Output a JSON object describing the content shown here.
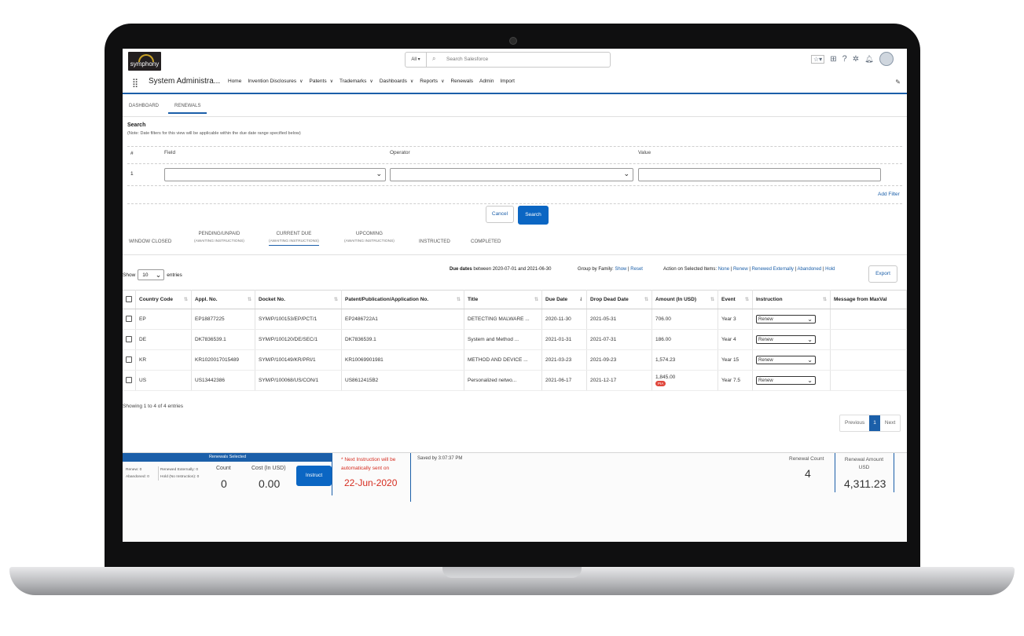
{
  "header": {
    "logo_text": "symphony",
    "search_scope": "All",
    "search_placeholder": "Search Salesforce",
    "app_name": "System Administra...",
    "nav": [
      "Home",
      "Invention Disclosures",
      "Patents",
      "Trademarks",
      "Dashboards",
      "Reports",
      "Renewals",
      "Admin",
      "Import"
    ],
    "nav_has_menu": [
      false,
      true,
      true,
      true,
      true,
      true,
      false,
      false,
      false
    ]
  },
  "subtabs": [
    "DASHBOARD",
    "RENEWALS"
  ],
  "search": {
    "title": "Search",
    "note": "(Note: Date filters for this view will be applicable within the due date range specified below)",
    "col_hash": "#",
    "col_field": "Field",
    "col_operator": "Operator",
    "col_value": "Value",
    "row_number": "1",
    "add_filter": "Add Filter",
    "cancel": "Cancel",
    "search": "Search"
  },
  "status_tabs": [
    {
      "label": "WINDOW CLOSED",
      "sub": ""
    },
    {
      "label": "PENDING/UNPAID",
      "sub": "(AWAITING INSTRUCTIONS)"
    },
    {
      "label": "CURRENT DUE",
      "sub": "(AWAITING INSTRUCTIONS)"
    },
    {
      "label": "UPCOMING",
      "sub": "(AWAITING INSTRUCTIONS)"
    },
    {
      "label": "INSTRUCTED",
      "sub": ""
    },
    {
      "label": "COMPLETED",
      "sub": ""
    }
  ],
  "toolbar": {
    "show": "Show",
    "entries_value": "10",
    "entries": "entries",
    "due_dates_label": "Due dates",
    "due_dates_range": "between 2020-07-01 and 2021-06-30",
    "group_by": "Group by Family:",
    "group_show": "Show",
    "group_reset": "Reset",
    "action_label": "Action on Selected Items:",
    "actions": [
      "None",
      "Renew",
      "Renewed Externally",
      "Abandoned",
      "Hold"
    ],
    "export": "Export"
  },
  "table": {
    "headers": [
      "Country Code",
      "Appl. No.",
      "Docket No.",
      "Patent/Publication/Application No.",
      "Title",
      "Due Date",
      "Drop Dead Date",
      "Amount (In USD)",
      "Event",
      "Instruction",
      "Message from MaxVal"
    ],
    "rows": [
      {
        "country": "EP",
        "appl": "EP18877225",
        "docket": "SYM/P/100153/EP/PCT/1",
        "patent": "EP2486722A1",
        "title": "DETECTING MALWARE ...",
        "due": "2020-11-30",
        "drop": "2021-05-31",
        "amount": "706.00",
        "event": "Year 3",
        "instruction": "Renew",
        "badge": ""
      },
      {
        "country": "DE",
        "appl": "DK7836539.1",
        "docket": "SYM/P/100120/DE/SEC/1",
        "patent": "DK7836539.1",
        "title": "System and Method ...",
        "due": "2021-01-31",
        "drop": "2021-07-31",
        "amount": "186.00",
        "event": "Year 4",
        "instruction": "Renew",
        "badge": ""
      },
      {
        "country": "KR",
        "appl": "KR1020017015489",
        "docket": "SYM/P/100149/KR/PRI/1",
        "patent": "KR10069901981",
        "title": "METHOD AND DEVICE ...",
        "due": "2021-03-23",
        "drop": "2021-09-23",
        "amount": "1,574.23",
        "event": "Year 15",
        "instruction": "Renew",
        "badge": ""
      },
      {
        "country": "US",
        "appl": "US13442386",
        "docket": "SYM/P/100068/US/CON/1",
        "patent": "US8612415B2",
        "title": "Personalized netwo...",
        "due": "2021-06-17",
        "drop": "2021-12-17",
        "amount": "1,845.00",
        "event": "Year 7.5",
        "instruction": "Renew",
        "badge": "PIA"
      }
    ]
  },
  "pagination": {
    "info": "Showing 1 to 4 of 4 entries",
    "previous": "Previous",
    "page": "1",
    "next": "Next"
  },
  "footer": {
    "renewals_selected": "Renewals Selected",
    "renew_count": "Renew: 0",
    "renewed_externally": "Renewed Externally: 0",
    "abandoned": "Abandoned: 0",
    "hold": "Hold (No Instruction): 0",
    "count_label": "Count",
    "count_value": "0",
    "cost_label": "Cost (In USD)",
    "cost_value": "0.00",
    "instruct": "Instruct",
    "next_instruction_1": "* Next Instruction will be",
    "next_instruction_2": "automatically sent on",
    "next_date": "22-Jun-2020",
    "saved": "Saved by 3:07:37 PM",
    "renewal_count_label": "Renewal Count",
    "renewal_count_value": "4",
    "renewal_amount_label_1": "Renewal Amount",
    "renewal_amount_label_2": "USD",
    "renewal_amount_value": "4,311.23"
  },
  "colors": {
    "accent": "#1b5fa9",
    "primary_button": "#0b66c3",
    "alert": "#e0473c"
  }
}
